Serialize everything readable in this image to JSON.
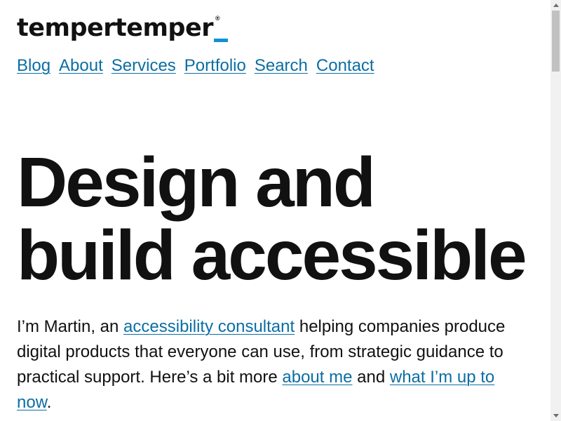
{
  "site": {
    "logo_text": "tempertemper",
    "logo_registered": "®",
    "logo_underscore_color": "#0f92d3"
  },
  "nav": {
    "items": [
      {
        "label": "Blog"
      },
      {
        "label": "About"
      },
      {
        "label": "Services"
      },
      {
        "label": "Portfolio"
      },
      {
        "label": "Search"
      },
      {
        "label": "Contact"
      }
    ]
  },
  "hero": {
    "line1": "Design and",
    "line2": "build accessible"
  },
  "intro": {
    "text1": "I’m Martin, an ",
    "link1": "accessibility consultant",
    "text2": " helping companies produce digital products that everyone can use, from strategic guidance to practical support. Here’s a bit more ",
    "link2": "about me",
    "text3": " and ",
    "link3": "what I’m up to now",
    "text4": "."
  },
  "colors": {
    "link": "#0b6ea3",
    "text": "#111111",
    "accent": "#0f92d3"
  },
  "icons": {
    "scroll_up": "triangle-up-icon",
    "scroll_down": "triangle-down-icon"
  }
}
